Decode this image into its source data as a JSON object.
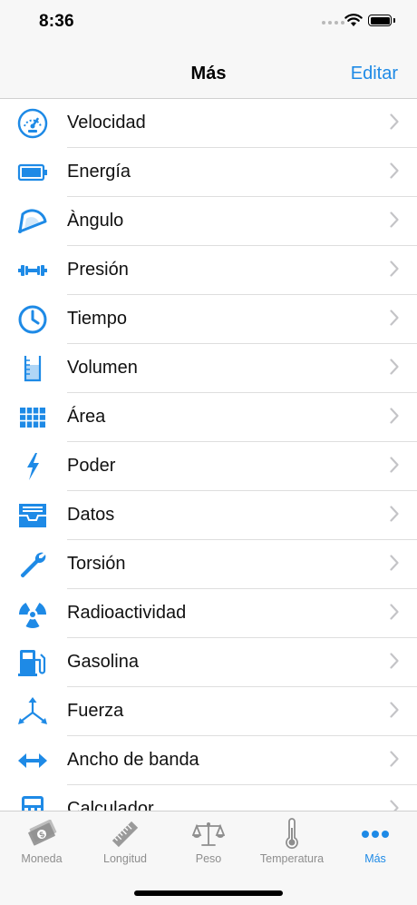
{
  "status": {
    "time": "8:36"
  },
  "nav": {
    "title": "Más",
    "edit_label": "Editar"
  },
  "items": [
    {
      "label": "Velocidad",
      "icon": "speedometer-icon"
    },
    {
      "label": "Energía",
      "icon": "battery-icon"
    },
    {
      "label": "Àngulo",
      "icon": "protractor-icon"
    },
    {
      "label": "Presión",
      "icon": "dumbbell-icon"
    },
    {
      "label": "Tiempo",
      "icon": "clock-icon"
    },
    {
      "label": "Volumen",
      "icon": "beaker-icon"
    },
    {
      "label": "Área",
      "icon": "grid-icon"
    },
    {
      "label": "Poder",
      "icon": "lightning-icon"
    },
    {
      "label": "Datos",
      "icon": "inbox-icon"
    },
    {
      "label": "Torsión",
      "icon": "wrench-icon"
    },
    {
      "label": "Radioactividad",
      "icon": "radiation-icon"
    },
    {
      "label": "Gasolina",
      "icon": "fuel-pump-icon"
    },
    {
      "label": "Fuerza",
      "icon": "force-arrows-icon"
    },
    {
      "label": "Ancho de banda",
      "icon": "double-arrow-icon"
    },
    {
      "label": "Calculador",
      "icon": "calculator-icon"
    }
  ],
  "tabs": [
    {
      "label": "Moneda",
      "icon": "money-icon"
    },
    {
      "label": "Longitud",
      "icon": "ruler-icon"
    },
    {
      "label": "Peso",
      "icon": "scale-icon"
    },
    {
      "label": "Temperatura",
      "icon": "thermometer-icon"
    },
    {
      "label": "Más",
      "icon": "more-dots-icon",
      "active": true
    }
  ],
  "colors": {
    "accent": "#1e8ae6",
    "inactive": "#8e8e8e"
  }
}
